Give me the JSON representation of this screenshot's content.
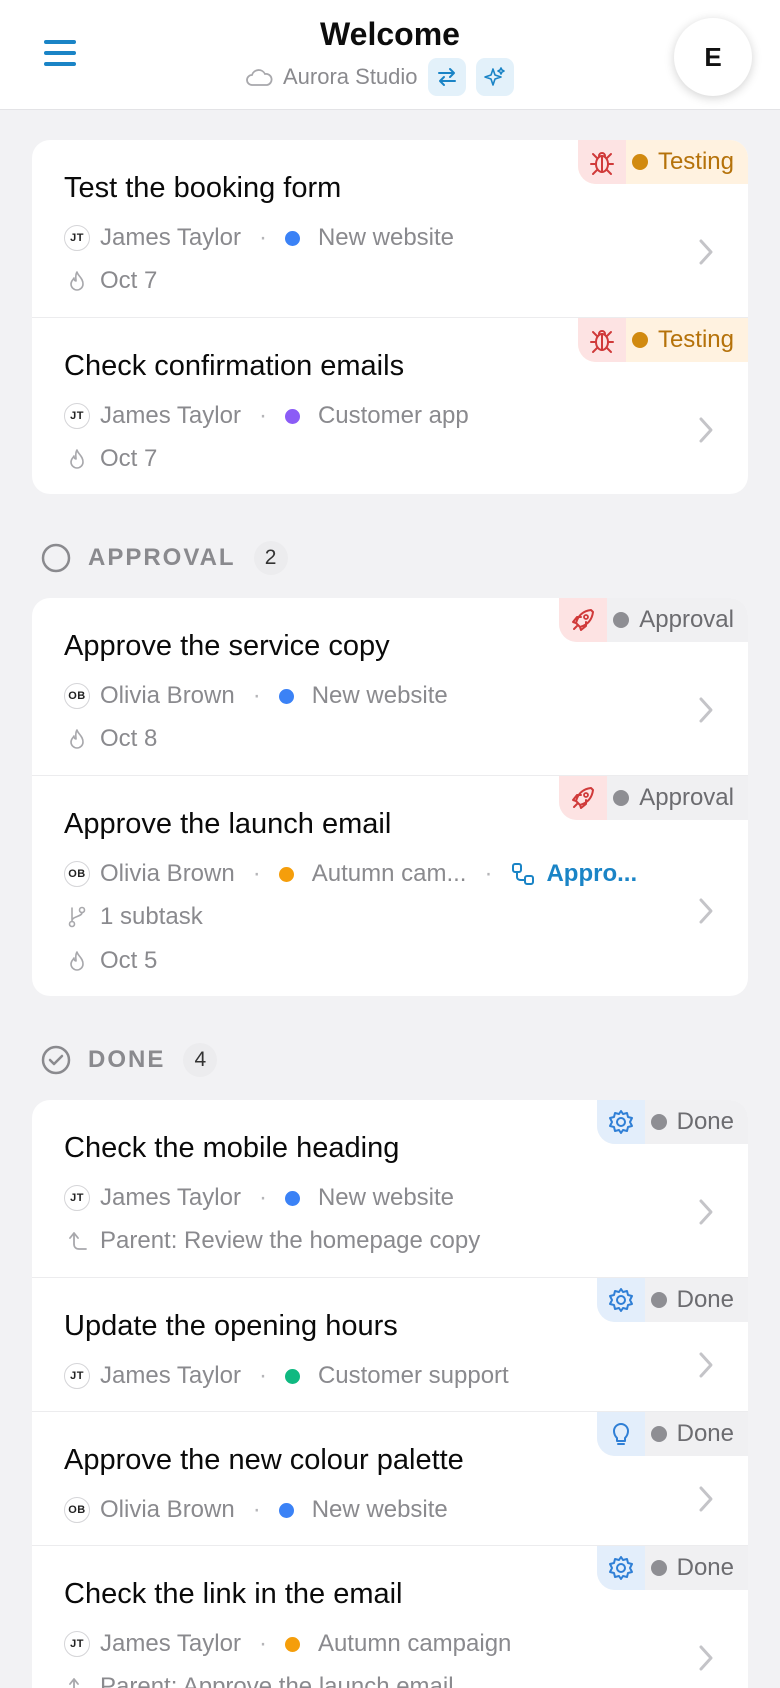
{
  "header": {
    "title": "Welcome",
    "org_name": "Aurora Studio",
    "avatar_initial": "E",
    "accent": "#1a84c6"
  },
  "sections": {
    "approval": {
      "label": "APPROVAL",
      "count": "2"
    },
    "done": {
      "label": "DONE",
      "count": "4"
    }
  },
  "tasks": [
    {
      "title": "Test the booking form",
      "initials": "JT",
      "assignee": "James Taylor",
      "project": "New website",
      "project_color": "#3b82f6",
      "date": "Oct 7",
      "status": "Testing",
      "status_icon": "bug-icon"
    },
    {
      "title": "Check confirmation emails",
      "initials": "JT",
      "assignee": "James Taylor",
      "project": "Customer app",
      "project_color": "#8b5cf6",
      "date": "Oct 7",
      "status": "Testing",
      "status_icon": "bug-icon"
    },
    {
      "title": "Approve the service copy",
      "initials": "OB",
      "assignee": "Olivia Brown",
      "project": "New website",
      "project_color": "#3b82f6",
      "date": "Oct 8",
      "status": "Approval",
      "status_icon": "rocket-icon"
    },
    {
      "title": "Approve the launch email",
      "initials": "OB",
      "assignee": "Olivia Brown",
      "project": "Autumn cam...",
      "project_color": "#f59e0b",
      "link": "Appro...",
      "subtasks": "1 subtask",
      "date": "Oct 5",
      "status": "Approval",
      "status_icon": "rocket-icon"
    },
    {
      "title": "Check the mobile heading",
      "initials": "JT",
      "assignee": "James Taylor",
      "project": "New website",
      "project_color": "#3b82f6",
      "parent": "Parent: Review the homepage copy",
      "status": "Done",
      "status_icon": "gear-icon"
    },
    {
      "title": "Update the opening hours",
      "initials": "JT",
      "assignee": "James Taylor",
      "project": "Customer support",
      "project_color": "#10b981",
      "status": "Done",
      "status_icon": "gear-icon"
    },
    {
      "title": "Approve the new colour palette",
      "initials": "OB",
      "assignee": "Olivia Brown",
      "project": "New website",
      "project_color": "#3b82f6",
      "status": "Done",
      "status_icon": "lightbulb-icon"
    },
    {
      "title": "Check the link in the email",
      "initials": "JT",
      "assignee": "James Taylor",
      "project": "Autumn campaign",
      "project_color": "#f59e0b",
      "parent": "Parent: Approve the launch email",
      "status": "Done",
      "status_icon": "gear-icon"
    }
  ]
}
